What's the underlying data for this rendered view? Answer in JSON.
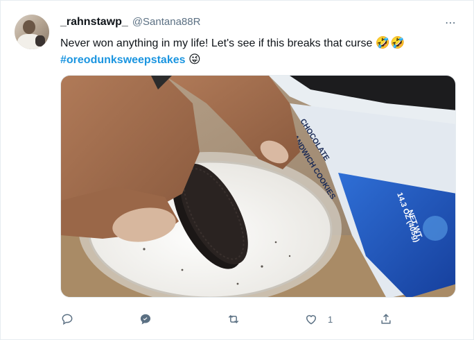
{
  "user": {
    "display_name": "_rahnstawp_",
    "handle": "@Santana88R"
  },
  "more_icon": "⋯",
  "tweet": {
    "text": "Never won anything in my life! Let's see if this breaks that curse",
    "text_emoji": "🤣🤣",
    "hashtag": "#oreodunksweepstakes",
    "hashtag_emoji": "😜"
  },
  "media": {
    "package_text_1": "CHOCOLATE",
    "package_text_2": "SANDWICH COOKIES",
    "package_weight_1": "NET WT",
    "package_weight_2": "14.3 OZ (405g)"
  },
  "actions": {
    "reply_icon": "reply-icon",
    "quote_icon": "quote-icon",
    "retweet_icon": "retweet-icon",
    "like_icon": "like-icon",
    "like_count": "1",
    "share_icon": "share-icon"
  },
  "colors": {
    "accent": "#1b95e0",
    "muted": "#5b7083",
    "text": "#0f1419"
  }
}
